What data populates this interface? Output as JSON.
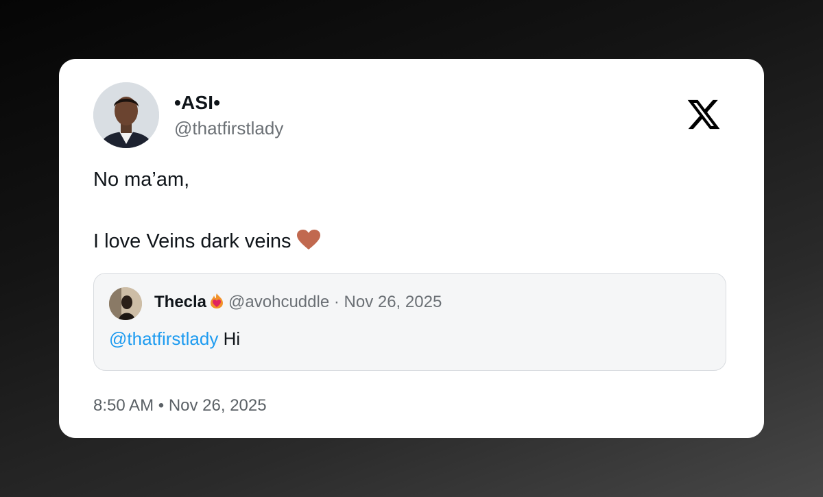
{
  "author": {
    "display_name": "•ASI•",
    "handle": "@thatfirstlady"
  },
  "tweet": {
    "line1": "No ma’am,",
    "line2": "I love Veins dark veins",
    "emoji": "brown-heart-icon"
  },
  "quoted": {
    "display_name": "Thecla",
    "badge": "heart-on-fire-icon",
    "handle": "@avohcuddle",
    "separator": "·",
    "date": "Nov 26, 2025",
    "mention": "@thatfirstlady",
    "text": "Hi"
  },
  "footer": {
    "time": "8:50 AM",
    "separator": "•",
    "date": "Nov 26, 2025"
  },
  "colors": {
    "mention": "#1d9bf0",
    "heart": "#c1694f",
    "card": "#ffffff",
    "quote_bg": "#f5f6f7"
  }
}
